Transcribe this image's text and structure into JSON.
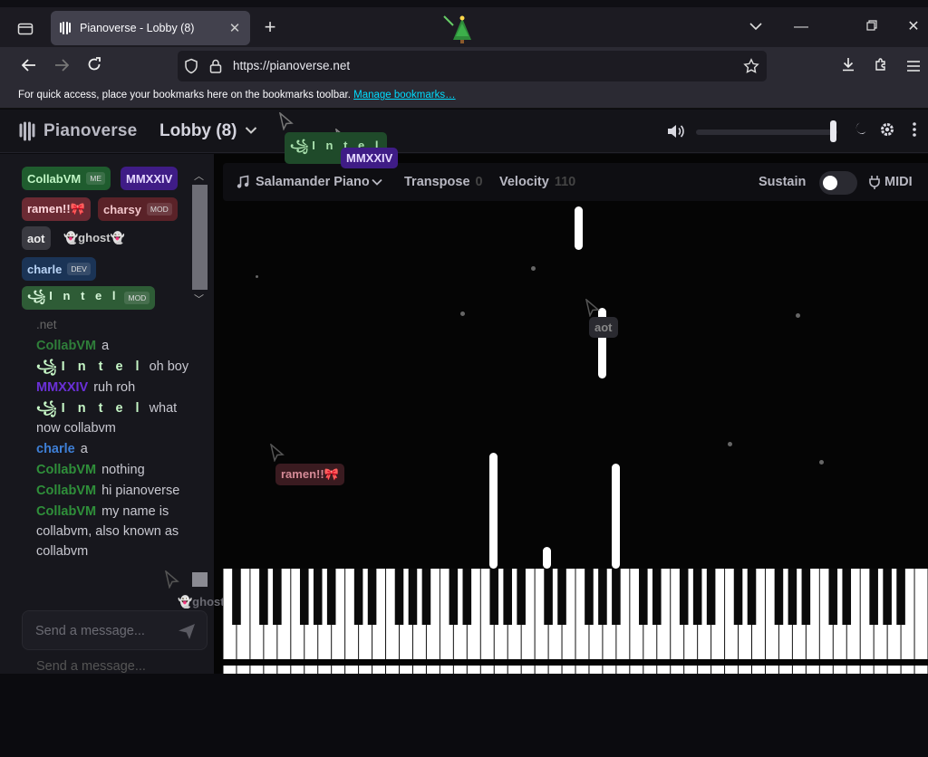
{
  "browser": {
    "tab_title": "Pianoverse - Lobby (8)",
    "tab_close": "✕",
    "new_tab": "+",
    "url": "https://pianoverse.net",
    "bookmark_bar_text": "For quick access, place your bookmarks here on the bookmarks toolbar.",
    "bookmark_link": "Manage bookmarks…",
    "window_controls": {
      "list_tabs": "⌄",
      "minimize": "—",
      "restore": "⧉",
      "close": "✕"
    }
  },
  "header": {
    "logo_text": "Pianoverse",
    "room_title": "Lobby (8)",
    "volume_level": 0.97
  },
  "users": [
    {
      "name": "CollabVM",
      "badge": "ME",
      "color": "#1f5c2e",
      "text": "#bff5c4"
    },
    {
      "name": "MMXXIV",
      "badge": "",
      "color": "#3f1c86",
      "text": "#e5d8ff"
    },
    {
      "name": "ramen!!🎀",
      "badge": "",
      "color": "#6b2a33",
      "text": "#ffd6dc"
    },
    {
      "name": "charsy",
      "badge": "MOD",
      "color": "#5a2228",
      "text": "#f2c6cb"
    },
    {
      "name": "aot",
      "badge": "",
      "color": "#3a3a41",
      "text": "#eeeeee"
    },
    {
      "name": "👻ghost👻",
      "badge": "",
      "color": "transparent",
      "text": "#cccccc"
    },
    {
      "name": "charle",
      "badge": "DEV",
      "color": "#1b3456",
      "text": "#b9d4f6"
    },
    {
      "name": "꧁I n t e l",
      "badge": "MOD",
      "color": "#2e5c36",
      "text": "#d6f6d8"
    }
  ],
  "chat": {
    "system_line": ".net",
    "messages": [
      {
        "who": "CollabVM",
        "color": "#2f7f3a",
        "text": "a",
        "style": ""
      },
      {
        "who": "꧁I n t e l",
        "color": "#c6f6c6",
        "text": "oh boy",
        "style": "intel"
      },
      {
        "who": "MMXXIV",
        "color": "#6b30d8",
        "text": "ruh roh",
        "style": ""
      },
      {
        "who": "꧁I n t e l",
        "color": "#c6f6c6",
        "text": "what now collabvm",
        "style": "intel"
      },
      {
        "who": "charle",
        "color": "#3e7fd6",
        "text": "a",
        "style": ""
      },
      {
        "who": "CollabVM",
        "color": "#2f8f3a",
        "text": "nothing",
        "style": ""
      },
      {
        "who": "CollabVM",
        "color": "#2f8f3a",
        "text": "hi pianoverse",
        "style": ""
      },
      {
        "who": "CollabVM",
        "color": "#2f8f3a",
        "text": "my name is collabvm, also known as collabvm",
        "style": ""
      }
    ],
    "input_placeholder": "Send a message...",
    "ghost_input_text": "Send a message..."
  },
  "toolbar": {
    "instrument": "Salamander Piano",
    "transpose_label": "Transpose",
    "transpose_value": "0",
    "velocity_label": "Velocity",
    "velocity_value": "110",
    "sustain_label": "Sustain",
    "sustain_on": false,
    "midi_label": "MIDI"
  },
  "cursors": [
    {
      "name": "꧁I n t e l",
      "bg": "#1f4a2a",
      "fg": "#a9e0ad"
    },
    {
      "name": "MMXXIV",
      "bg": "#3f1c86",
      "fg": "#e5d8ff"
    },
    {
      "name": "aot",
      "bg": "#2a2a30",
      "fg": "#888888"
    },
    {
      "name": "ramen!!🎀",
      "bg": "#3a1b20",
      "fg": "#d48a96"
    },
    {
      "name": "👻ghost👻",
      "bg": "transparent",
      "fg": "#6a6a72"
    }
  ],
  "colors": {
    "accent": "#00ddff",
    "chrome_bg": "#2b2a33",
    "app_bg": "#050505"
  }
}
